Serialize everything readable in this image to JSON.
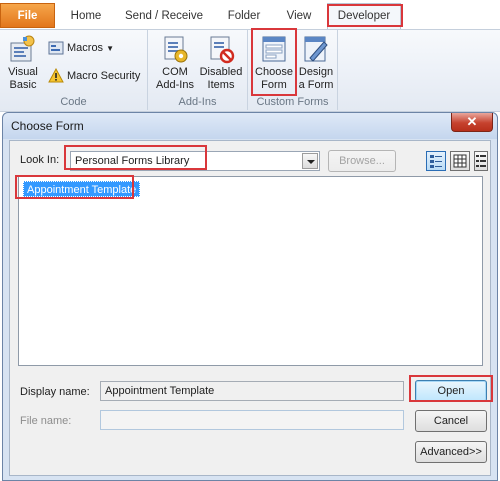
{
  "ribbon": {
    "tabs": [
      "File",
      "Home",
      "Send / Receive",
      "Folder",
      "View",
      "Developer"
    ],
    "groups": {
      "code": {
        "label": "Code",
        "visual_basic": [
          "Visual",
          "Basic"
        ],
        "macros": "Macros",
        "macro_security": "Macro Security"
      },
      "addins": {
        "label": "Add-Ins",
        "com_addins": [
          "COM",
          "Add-Ins"
        ],
        "disabled_items": [
          "Disabled",
          "Items"
        ]
      },
      "custom_forms": {
        "label": "Custom Forms",
        "choose_form": [
          "Choose",
          "Form"
        ],
        "design_form": [
          "Design",
          "a Form"
        ]
      }
    }
  },
  "dialog": {
    "title": "Choose Form",
    "close_glyph": "✕",
    "look_in_label": "Look In:",
    "look_in_value": "Personal Forms Library",
    "browse_label": "Browse...",
    "list_items": [
      "Appointment Template"
    ],
    "display_name_label": "Display name:",
    "display_name_value": "Appointment Template",
    "file_name_label": "File name:",
    "file_name_value": "",
    "open_label": "Open",
    "cancel_label": "Cancel",
    "advanced_label": "Advanced>>"
  },
  "colors": {
    "highlight": "#d9373b",
    "selection": "#3399ff",
    "file_tab": "#e2761c"
  }
}
